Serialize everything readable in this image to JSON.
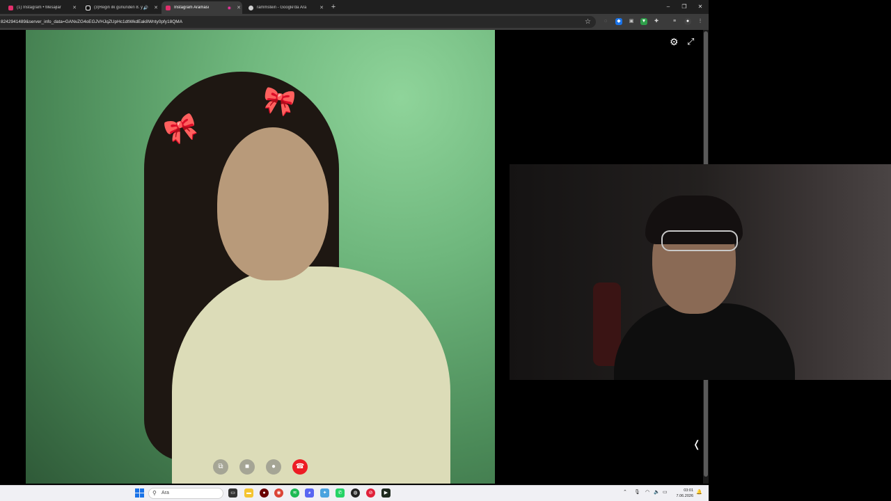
{
  "tabs": [
    {
      "title": "(1) Instagram • Mesajlar",
      "favicon_color": "#e1306c"
    },
    {
      "title": "(3)Regin ilk gününden 8. y",
      "favicon_color": "#ffffff"
    },
    {
      "title": "Instagram Araması",
      "favicon_color": "#e1306c"
    },
    {
      "title": "rammstein - Google'da Ara",
      "favicon_color": "#cfcfcf"
    }
  ],
  "address": {
    "url": "8242941489&server_info_data=GANvZG4oEGJVHJqZUpHc1dtWkdEak8Wnty0pfy18QMA"
  },
  "window_controls": {
    "minimize": "–",
    "maximize": "❐",
    "close": "✕"
  },
  "call": {
    "controls": [
      {
        "name": "flip-camera",
        "glyph": "⧉"
      },
      {
        "name": "camera",
        "glyph": "■"
      },
      {
        "name": "microphone",
        "glyph": "●"
      },
      {
        "name": "end-call",
        "glyph": "☎"
      }
    ],
    "end_call_color": "#ed1c24"
  },
  "taskbar": {
    "search_placeholder": "Ara",
    "time": "03:01",
    "date": "7.06.2026"
  }
}
